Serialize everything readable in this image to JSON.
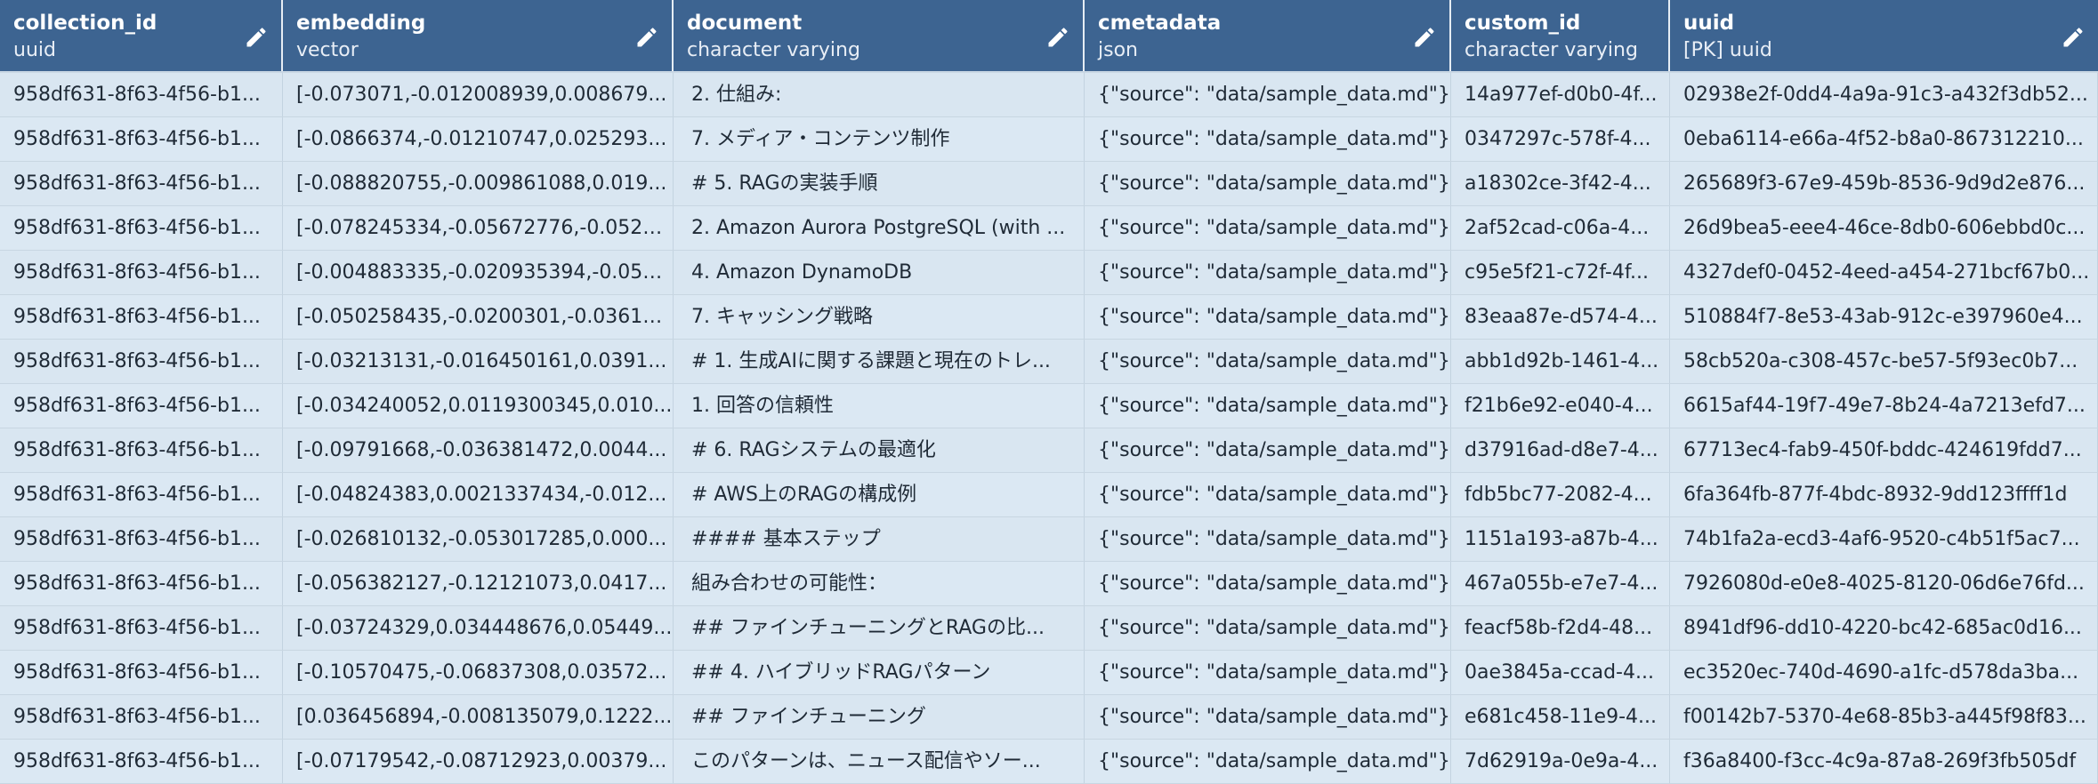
{
  "columns": [
    {
      "name": "collection_id",
      "type": "uuid"
    },
    {
      "name": "embedding",
      "type": "vector"
    },
    {
      "name": "document",
      "type": "character varying"
    },
    {
      "name": "cmetadata",
      "type": "json"
    },
    {
      "name": "custom_id",
      "type": "character varying"
    },
    {
      "name": "uuid",
      "type": "[PK] uuid"
    }
  ],
  "rows": [
    [
      "958df631-8f63-4f56-b1...",
      "[-0.073071,-0.012008939,0.008679...",
      "2. 仕組み:",
      "{\"source\": \"data/sample_data.md\"}",
      "14a977ef-d0b0-4f...",
      "02938e2f-0dd4-4a9a-91c3-a432f3db52..."
    ],
    [
      "958df631-8f63-4f56-b1...",
      "[-0.0866374,-0.01210747,0.025293...",
      "7. メディア・コンテンツ制作",
      "{\"source\": \"data/sample_data.md\"}",
      "0347297c-578f-4...",
      "0eba6114-e66a-4f52-b8a0-867312210..."
    ],
    [
      "958df631-8f63-4f56-b1...",
      "[-0.088820755,-0.009861088,0.019...",
      "# 5. RAGの実装手順",
      "{\"source\": \"data/sample_data.md\"}",
      "a18302ce-3f42-4...",
      "265689f3-67e9-459b-8536-9d9d2e876..."
    ],
    [
      "958df631-8f63-4f56-b1...",
      "[-0.078245334,-0.05672776,-0.0523...",
      "2. Amazon Aurora PostgreSQL (with ...",
      "{\"source\": \"data/sample_data.md\"}",
      "2af52cad-c06a-4...",
      "26d9bea5-eee4-46ce-8db0-606ebbd0c..."
    ],
    [
      "958df631-8f63-4f56-b1...",
      "[-0.004883335,-0.020935394,-0.057...",
      "4. Amazon DynamoDB",
      "{\"source\": \"data/sample_data.md\"}",
      "c95e5f21-c72f-4f...",
      "4327def0-0452-4eed-a454-271bcf67b0..."
    ],
    [
      "958df631-8f63-4f56-b1...",
      "[-0.050258435,-0.0200301,-0.03610...",
      "7. キャッシング戦略",
      "{\"source\": \"data/sample_data.md\"}",
      "83eaa87e-d574-4...",
      "510884f7-8e53-43ab-912c-e397960e4..."
    ],
    [
      "958df631-8f63-4f56-b1...",
      "[-0.03213131,-0.016450161,0.0391...",
      "# 1. 生成AIに関する課題と現在のトレ...",
      "{\"source\": \"data/sample_data.md\"}",
      "abb1d92b-1461-4...",
      "58cb520a-c308-457c-be57-5f93ec0b7..."
    ],
    [
      "958df631-8f63-4f56-b1...",
      "[-0.034240052,0.0119300345,0.010...",
      "1. 回答の信頼性",
      "{\"source\": \"data/sample_data.md\"}",
      "f21b6e92-e040-4...",
      "6615af44-19f7-49e7-8b24-4a7213efd7..."
    ],
    [
      "958df631-8f63-4f56-b1...",
      "[-0.09791668,-0.036381472,0.0044...",
      "# 6. RAGシステムの最適化",
      "{\"source\": \"data/sample_data.md\"}",
      "d37916ad-d8e7-4...",
      "67713ec4-fab9-450f-bddc-424619fdd7..."
    ],
    [
      "958df631-8f63-4f56-b1...",
      "[-0.04824383,0.0021337434,-0.012...",
      "#  AWS上のRAGの構成例",
      "{\"source\": \"data/sample_data.md\"}",
      "fdb5bc77-2082-4...",
      "6fa364fb-877f-4bdc-8932-9dd123ffff1d"
    ],
    [
      "958df631-8f63-4f56-b1...",
      "[-0.026810132,-0.053017285,0.000...",
      "#### 基本ステップ",
      "{\"source\": \"data/sample_data.md\"}",
      "1151a193-a87b-4...",
      "74b1fa2a-ecd3-4af6-9520-c4b51f5ac7..."
    ],
    [
      "958df631-8f63-4f56-b1...",
      "[-0.056382127,-0.12121073,0.0417...",
      "組み合わせの可能性：",
      "{\"source\": \"data/sample_data.md\"}",
      "467a055b-e7e7-4...",
      "7926080d-e0e8-4025-8120-06d6e76fd..."
    ],
    [
      "958df631-8f63-4f56-b1...",
      "[-0.03724329,0.034448676,0.05449...",
      "## ファインチューニングとRAGの比...",
      "{\"source\": \"data/sample_data.md\"}",
      "feacf58b-f2d4-48...",
      "8941df96-dd10-4220-bc42-685ac0d16..."
    ],
    [
      "958df631-8f63-4f56-b1...",
      "[-0.10570475,-0.06837308,0.03572...",
      "## 4. ハイブリッドRAGパターン",
      "{\"source\": \"data/sample_data.md\"}",
      "0ae3845a-ccad-4...",
      "ec3520ec-740d-4690-a1fc-d578da3ba..."
    ],
    [
      "958df631-8f63-4f56-b1...",
      "[0.036456894,-0.008135079,0.1222...",
      "## ファインチューニング",
      "{\"source\": \"data/sample_data.md\"}",
      "e681c458-11e9-4...",
      "f00142b7-5370-4e68-85b3-a445f98f83..."
    ],
    [
      "958df631-8f63-4f56-b1...",
      "[-0.07179542,-0.08712923,0.00379...",
      "このパターンは、ニュース配信やソー...",
      "{\"source\": \"data/sample_data.md\"}",
      "7d62919a-0e9a-4...",
      "f36a8400-f3cc-4c9a-87a8-269f3fb505df"
    ]
  ],
  "colors": {
    "header_bg": "#3d6491",
    "row_bg": "#dbe8f3",
    "text": "#1f2a36"
  },
  "icons": {
    "edit": "pencil-icon"
  }
}
